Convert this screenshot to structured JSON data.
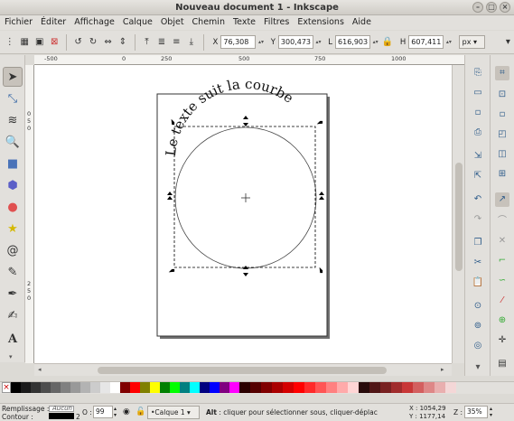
{
  "window": {
    "title": "Nouveau document 1 - Inkscape"
  },
  "menu": [
    "Fichier",
    "Éditer",
    "Affichage",
    "Calque",
    "Objet",
    "Chemin",
    "Texte",
    "Filtres",
    "Extensions",
    "Aide"
  ],
  "coords": {
    "x_label": "X",
    "x_value": "76,308",
    "y_label": "Y",
    "y_value": "300,473",
    "w_label": "L",
    "w_value": "616,903",
    "h_label": "H",
    "h_value": "607,411",
    "unit": "px"
  },
  "rulers": {
    "h_labels": [
      "-500",
      "0",
      "250",
      "500",
      "750",
      "1000"
    ],
    "v_labels": [
      "0",
      "5",
      "0",
      "2",
      "5",
      "0"
    ]
  },
  "canvas": {
    "curved_text": "Le texte suit la courbe"
  },
  "palette": {
    "none_symbol": "×",
    "colors": [
      "#000000",
      "#1a1a1a",
      "#333333",
      "#4d4d4d",
      "#666666",
      "#808080",
      "#999999",
      "#b3b3b3",
      "#cccccc",
      "#e6e6e6",
      "#ffffff",
      "#800000",
      "#ff0000",
      "#808000",
      "#ffff00",
      "#008000",
      "#00ff00",
      "#008080",
      "#00ffff",
      "#000080",
      "#0000ff",
      "#800080",
      "#ff00ff",
      "#2b0000",
      "#550000",
      "#800000",
      "#aa0000",
      "#d40000",
      "#ff0000",
      "#ff2a2a",
      "#ff5555",
      "#ff8080",
      "#ffaaaa",
      "#ffd5d5",
      "#280b0b",
      "#501616",
      "#782121",
      "#a02c2c",
      "#c83737",
      "#d35f5f",
      "#de8787",
      "#e9afaf",
      "#f4d7d7"
    ]
  },
  "status": {
    "fill_label": "Remplissage :",
    "fill_value": "Aucun",
    "stroke_label": "Contour :",
    "stroke_width": "2",
    "opacity_label": "O :",
    "opacity_value": "99",
    "layer": "•Calque 1",
    "message_bold": "Alt",
    "message": " : cliquer pour sélectionner sous, cliquer-déplac",
    "cursor_x": "X : 1054,29",
    "cursor_y": "Y : 1177,14",
    "zoom_label": "Z :",
    "zoom_value": "35%"
  }
}
